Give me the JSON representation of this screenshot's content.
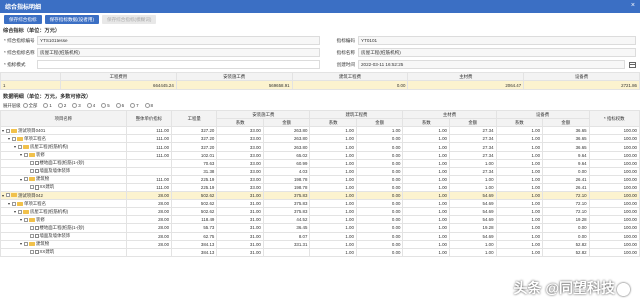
{
  "window": {
    "title": "综合指标明细",
    "close": "×"
  },
  "toolbar": {
    "btn1": "保存综合指标",
    "btn2": "保存指标数据(设者用)",
    "btn3": "保存综合指标(模糊词)"
  },
  "section1": "综合指标（单位：万元）",
  "form": {
    "l1": "* 综合指标编号",
    "v1": "YTS101tesse",
    "l2": "指标编码",
    "v2": "YT0101",
    "l3": "* 综合指标名称",
    "v3": "房屋工程(桩筋机构)",
    "l4": "指标名称",
    "v4": "房屋工程(桩筋机构)",
    "l5": "* 指标模式",
    "v5": "",
    "l6": "创建时间",
    "v6": "2022-03-11 16:52:25"
  },
  "summary": {
    "headers": [
      "",
      "工程费用",
      "安装施工费",
      "建筑工程费",
      "主材费",
      "设备费"
    ],
    "row": [
      "1",
      "664445.24",
      "569658.91",
      "0.00",
      "2064.47",
      "2721.86"
    ]
  },
  "detail_title": "数据明细（单位：万元，多数可修改）",
  "levels": {
    "label": "展开层级",
    "options": [
      "全部",
      "1",
      "2",
      "3",
      "4",
      "5",
      "6",
      "7",
      "8"
    ]
  },
  "detail": {
    "h": [
      "项目名称",
      "整体单价指标",
      "工程量",
      "安装施工费",
      "",
      "建筑工程费",
      "",
      "主材费",
      "",
      "设备费",
      "",
      "* 指标权数"
    ],
    "sub": [
      "系数",
      "金额",
      "系数",
      "金额",
      "系数",
      "金额",
      "系数",
      "金额"
    ],
    "rows": [
      {
        "lvl": 0,
        "hl": false,
        "n": "测试项目0401",
        "c": [
          "111.00",
          "327.20",
          "33.00",
          "263.80",
          "1.00",
          "1.00",
          "27.34",
          "36.65",
          "100.00"
        ],
        "b": [
          "",
          "",
          "",
          "",
          "",
          "0.00",
          "",
          "",
          "",
          ""
        ]
      },
      {
        "lvl": 1,
        "hl": false,
        "n": "单项工程名",
        "c": [
          "111.00",
          "327.20",
          "33.00",
          "263.80",
          "1.00",
          "0.00",
          "27.34",
          "36.65",
          "100.00"
        ]
      },
      {
        "lvl": 2,
        "hl": false,
        "n": "房屋工程(桩筋机构)",
        "c": [
          "111.00",
          "327.20",
          "33.00",
          "263.80",
          "1.00",
          "0.00",
          "27.34",
          "36.65",
          "100.00"
        ]
      },
      {
        "lvl": 3,
        "hl": false,
        "n": "装修",
        "c": [
          "111.00",
          "102.01",
          "33.00",
          "65.02",
          "1.00",
          "0.00",
          "27.34",
          "9.64",
          "100.00"
        ]
      },
      {
        "lvl": 4,
        "hl": false,
        "n": "楼地面工程(桩筋)1-(砂)",
        "c": [
          "",
          "70.63",
          "33.00",
          "60.99",
          "1.00",
          "0.00",
          "1.00",
          "9.64",
          "100.00"
        ]
      },
      {
        "lvl": 4,
        "hl": false,
        "n": "墙面及墙体装饰",
        "c": [
          "",
          "31.38",
          "33.00",
          "4.03",
          "1.00",
          "0.00",
          "27.34",
          "0.00",
          "100.00"
        ]
      },
      {
        "lvl": 3,
        "hl": false,
        "n": "建筑物",
        "c": [
          "111.00",
          "225.19",
          "33.00",
          "198.78",
          "1.00",
          "0.00",
          "1.00",
          "26.41",
          "100.00"
        ]
      },
      {
        "lvl": 4,
        "hl": false,
        "n": "XX建筑",
        "c": [
          "111.00",
          "225.19",
          "33.00",
          "198.78",
          "1.00",
          "0.00",
          "1.00",
          "26.41",
          "100.00"
        ]
      },
      {
        "lvl": 0,
        "hl": true,
        "n": "测试项目042",
        "c": [
          "28.00",
          "502.62",
          "31.00",
          "375.83",
          "1.00",
          "0.00",
          "54.69",
          "72.10",
          "100.00"
        ]
      },
      {
        "lvl": 1,
        "hl": false,
        "n": "单项工程名",
        "c": [
          "28.00",
          "502.62",
          "31.00",
          "375.83",
          "1.00",
          "0.00",
          "54.69",
          "72.10",
          "100.00"
        ]
      },
      {
        "lvl": 2,
        "hl": false,
        "n": "房屋工程(桩筋机构)",
        "c": [
          "28.00",
          "502.62",
          "31.00",
          "375.83",
          "1.00",
          "0.00",
          "54.69",
          "72.10",
          "100.00"
        ]
      },
      {
        "lvl": 3,
        "hl": false,
        "n": "装修",
        "c": [
          "28.00",
          "118.49",
          "31.00",
          "44.52",
          "1.00",
          "0.00",
          "54.69",
          "19.28",
          "100.00"
        ]
      },
      {
        "lvl": 4,
        "hl": false,
        "n": "楼地面工程(桩筋)1-(砂)",
        "c": [
          "28.00",
          "55.73",
          "31.00",
          "36.45",
          "1.00",
          "0.00",
          "19.28",
          "0.00",
          "100.00"
        ]
      },
      {
        "lvl": 4,
        "hl": false,
        "n": "墙面及墙体装饰",
        "c": [
          "28.00",
          "62.75",
          "31.00",
          "8.07",
          "1.00",
          "0.00",
          "54.69",
          "0.00",
          "100.00"
        ]
      },
      {
        "lvl": 3,
        "hl": false,
        "n": "建筑物",
        "c": [
          "28.00",
          "384.13",
          "31.00",
          "331.31",
          "1.00",
          "0.00",
          "1.00",
          "52.82",
          "100.00"
        ]
      },
      {
        "lvl": 4,
        "hl": false,
        "n": "XX建筑",
        "c": [
          "",
          "384.13",
          "31.00",
          "",
          "1.00",
          "0.00",
          "1.00",
          "52.82",
          "100.00"
        ]
      }
    ]
  },
  "watermark": "头条 @同望科技"
}
